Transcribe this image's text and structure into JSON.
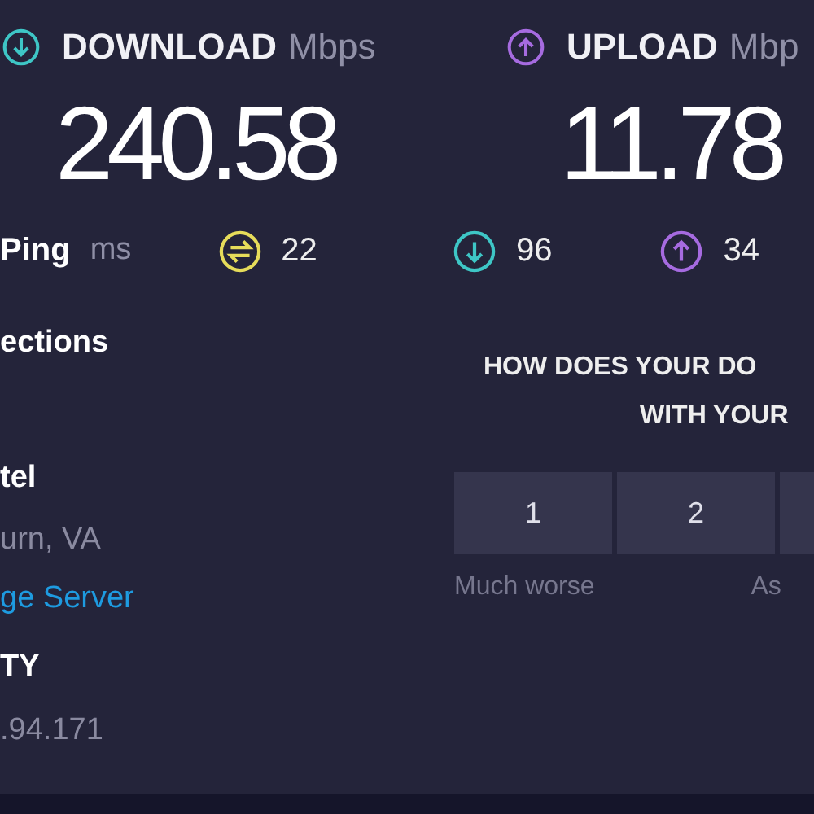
{
  "download": {
    "label": "DOWNLOAD",
    "unit": "Mbps",
    "value": "240.58"
  },
  "upload": {
    "label": "UPLOAD",
    "unit": "Mbp",
    "value": "11.78"
  },
  "ping": {
    "label": "Ping",
    "unit": "ms",
    "idle": "22",
    "download": "96",
    "upload": "34"
  },
  "connections": {
    "label": "ections"
  },
  "server": {
    "provider": "tel",
    "location": "urn, VA",
    "link": "ge Server"
  },
  "isp": {
    "label": "TY",
    "ip": ".94.171"
  },
  "survey": {
    "question_lines": [
      "HOW DOES YOUR DO",
      "WITH YOUR"
    ],
    "ratings": [
      {
        "label": "1"
      },
      {
        "label": "2"
      }
    ],
    "scale_labels": [
      "Much worse",
      "As"
    ]
  }
}
